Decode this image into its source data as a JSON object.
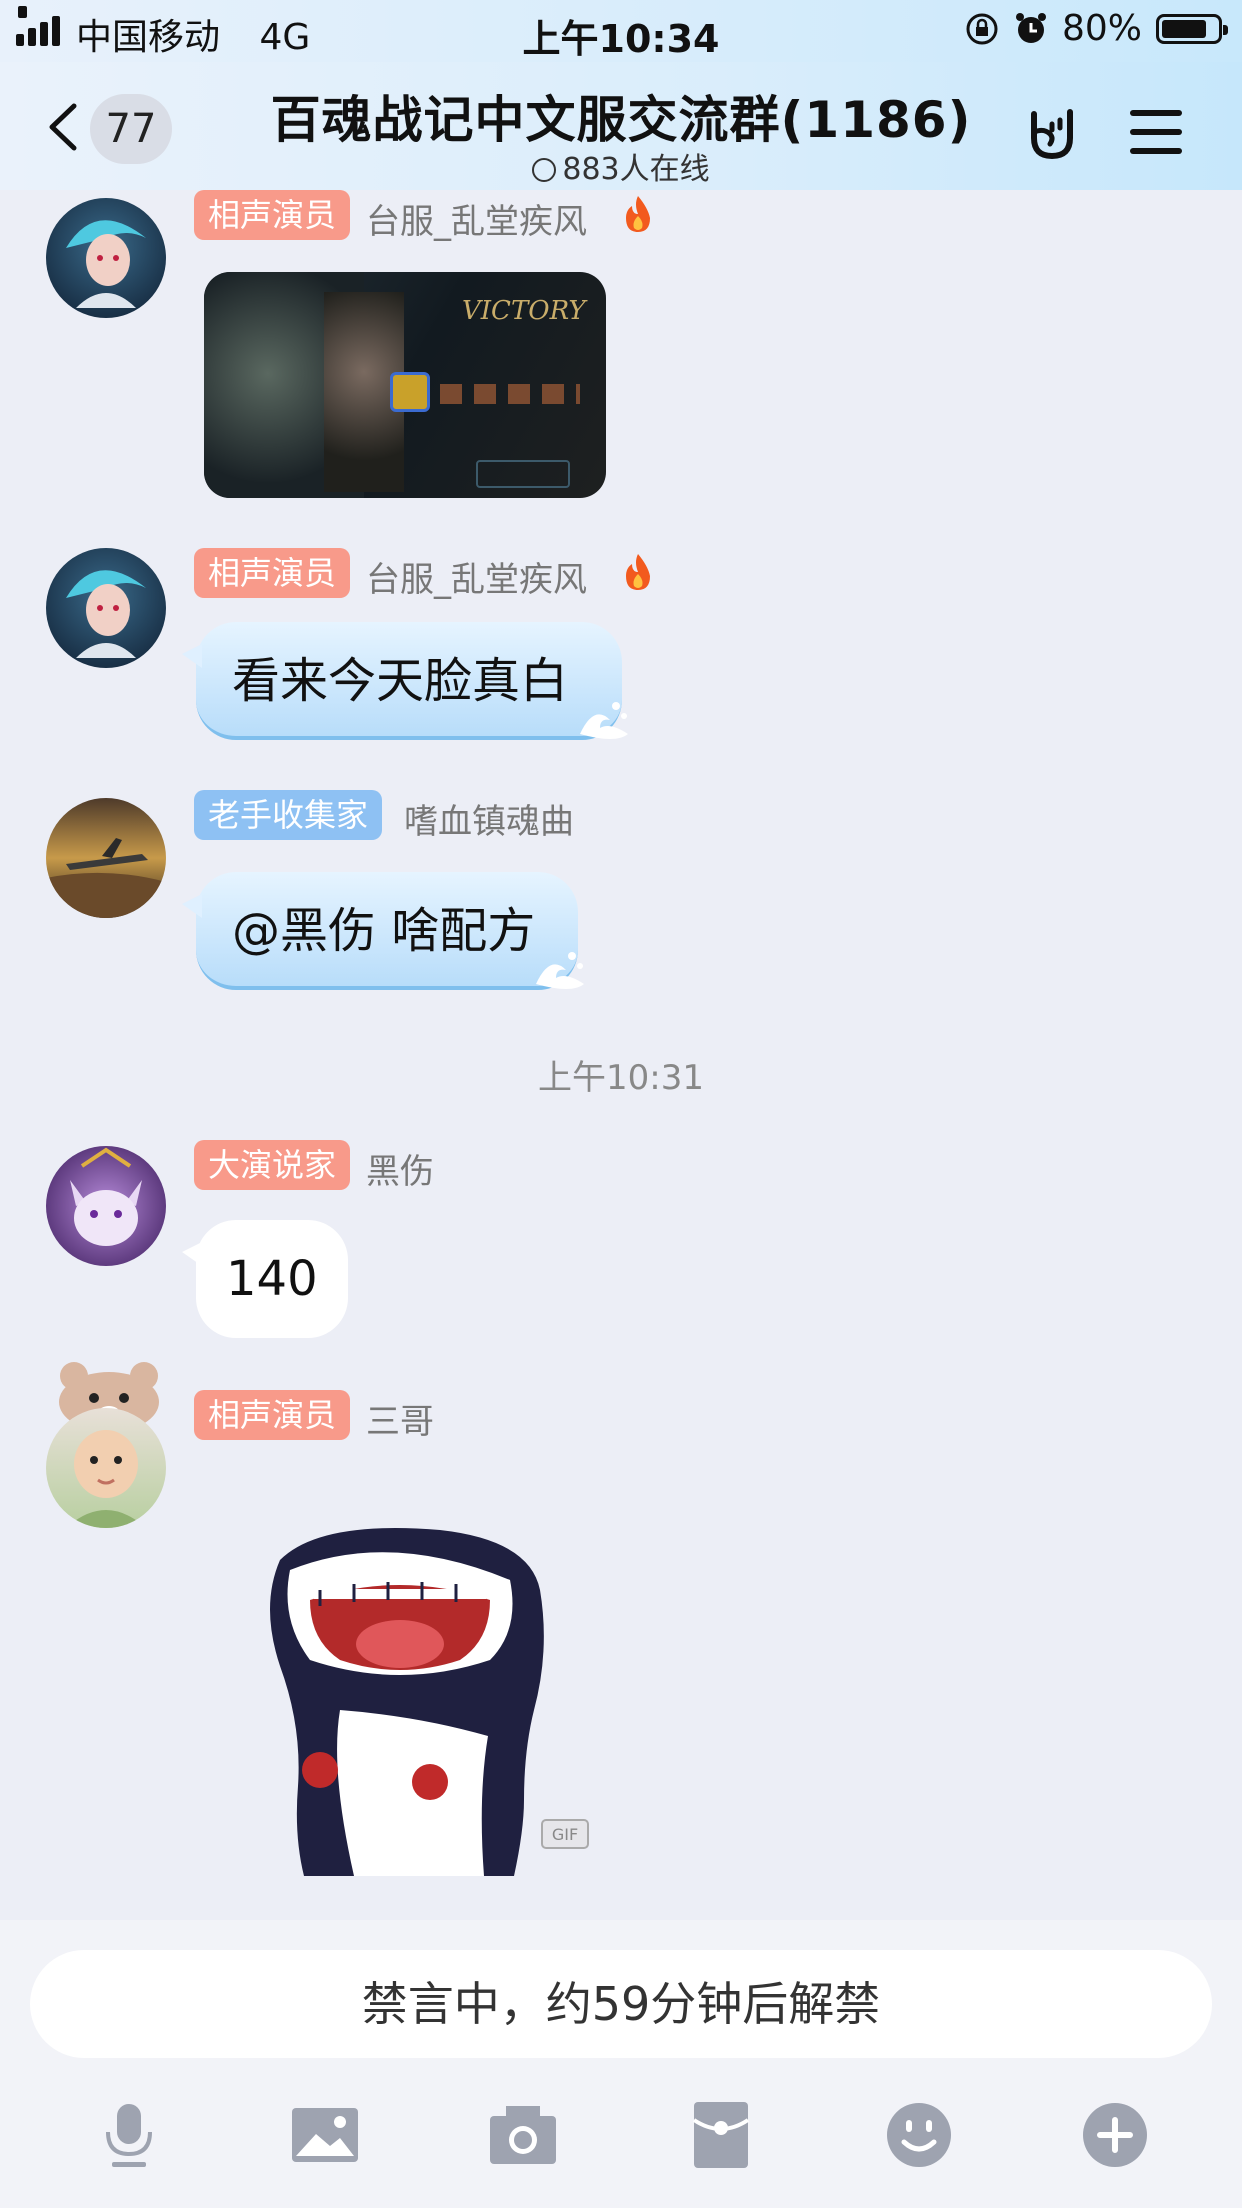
{
  "status": {
    "carrier": "中国移动",
    "network": "4G",
    "time": "上午10:34",
    "battery": "80%",
    "battery_level": 0.8
  },
  "header": {
    "unread_badge": "77",
    "title": "百魂战记中文服交流群(1186)",
    "online": "883人在线"
  },
  "messages": [
    {
      "tag": "相声演员",
      "tag_color": "#f89a8a",
      "nick": "台服_乱堂疾风",
      "type": "image",
      "image_text": "VICTORY"
    },
    {
      "tag": "相声演员",
      "tag_color": "#f89a8a",
      "nick": "台服_乱堂疾风",
      "type": "text",
      "text": "看来今天脸真白"
    },
    {
      "tag": "老手收集家",
      "tag_color": "#8ec1f3",
      "nick": "嗜血镇魂曲",
      "type": "text",
      "text": "@黑伤 啥配方"
    },
    {
      "tag": "大演说家",
      "tag_color": "#f89a8a",
      "nick": "黑伤",
      "type": "text",
      "text": "140"
    },
    {
      "tag": "相声演员",
      "tag_color": "#f89a8a",
      "nick": "三哥",
      "type": "sticker",
      "sticker_badge": "GIF"
    }
  ],
  "timestamp": "上午10:31",
  "input": {
    "muted_notice": "禁言中，约59分钟后解禁"
  },
  "toolbar": [
    "microphone-icon",
    "image-icon",
    "camera-icon",
    "red-packet-icon",
    "emoji-icon",
    "plus-icon"
  ]
}
